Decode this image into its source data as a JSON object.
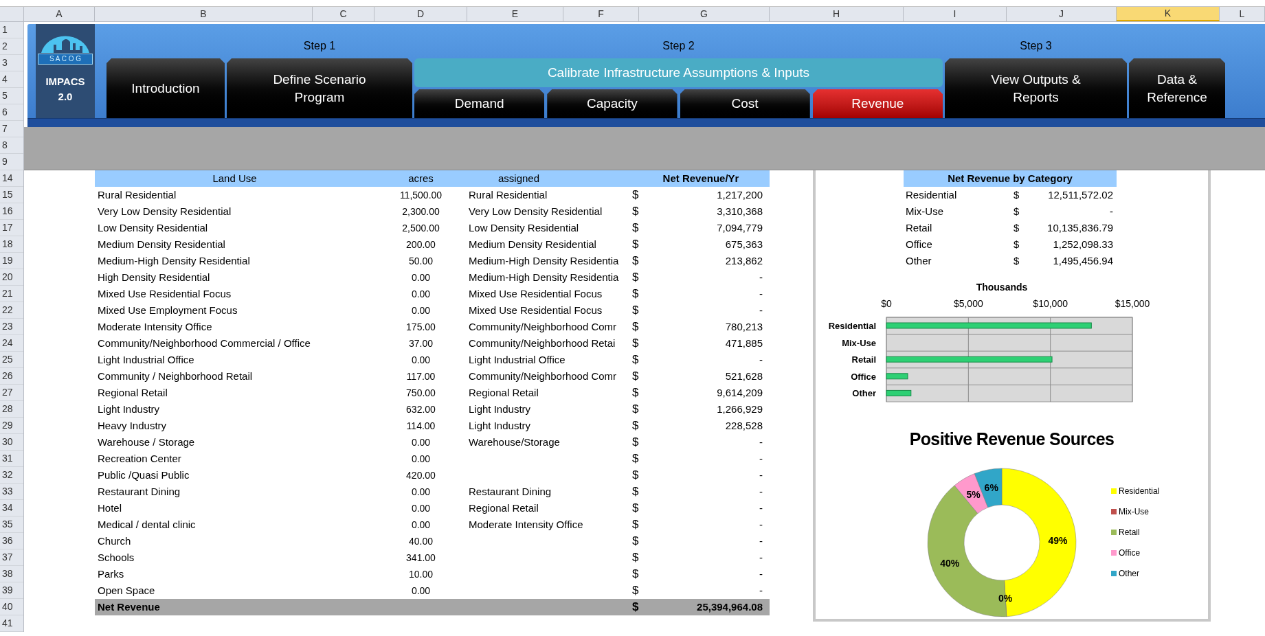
{
  "columns": [
    {
      "letter": "A",
      "selected": false
    },
    {
      "letter": "B",
      "selected": false
    },
    {
      "letter": "C",
      "selected": false
    },
    {
      "letter": "D",
      "selected": false
    },
    {
      "letter": "E",
      "selected": false
    },
    {
      "letter": "F",
      "selected": false
    },
    {
      "letter": "G",
      "selected": false
    },
    {
      "letter": "H",
      "selected": false
    },
    {
      "letter": "I",
      "selected": false
    },
    {
      "letter": "J",
      "selected": false
    },
    {
      "letter": "K",
      "selected": true
    },
    {
      "letter": "L",
      "selected": false
    }
  ],
  "row_numbers": [
    "1",
    "2",
    "3",
    "4",
    "5",
    "6",
    "7",
    "8",
    "9",
    "14",
    "15",
    "16",
    "17",
    "18",
    "19",
    "20",
    "21",
    "22",
    "23",
    "24",
    "25",
    "26",
    "27",
    "28",
    "29",
    "30",
    "31",
    "32",
    "33",
    "34",
    "35",
    "36",
    "37",
    "38",
    "39",
    "40",
    "41"
  ],
  "banner": {
    "logo_text": "S A C O G",
    "app_name": "IMPACS 2.0",
    "nav": [
      {
        "tabs": [
          {
            "label": "Introduction",
            "selected": false
          }
        ]
      },
      {
        "step": "Step 1",
        "tabs": [
          {
            "label": "Define Scenario Program",
            "selected": false
          }
        ]
      },
      {
        "step": "Step 2",
        "heading": "Calibrate Infrastructure Assumptions & Inputs",
        "tabs": [
          {
            "label": "Demand",
            "selected": false
          },
          {
            "label": "Capacity",
            "selected": false
          },
          {
            "label": "Cost",
            "selected": false
          },
          {
            "label": "Revenue",
            "selected": true
          }
        ]
      },
      {
        "step": "Step 3",
        "tabs": [
          {
            "label": "View Outputs & Reports",
            "selected": false
          }
        ]
      },
      {
        "tabs": [
          {
            "label": "Data & Reference",
            "selected": false
          }
        ]
      }
    ]
  },
  "land_use_table": {
    "columns": [
      "Land Use",
      "acres",
      "assigned",
      "Net Revenue/Yr"
    ],
    "rows": [
      {
        "land_use": "Rural Residential",
        "acres": "11,500.00",
        "assigned": "Rural Residential",
        "currency": "$",
        "net_revenue": "1,217,200"
      },
      {
        "land_use": "Very Low Density Residential",
        "acres": "2,300.00",
        "assigned": "Very Low Density Residential",
        "currency": "$",
        "net_revenue": "3,310,368"
      },
      {
        "land_use": "Low Density Residential",
        "acres": "2,500.00",
        "assigned": "Low Density Residential",
        "currency": "$",
        "net_revenue": "7,094,779"
      },
      {
        "land_use": "Medium Density Residential",
        "acres": "200.00",
        "assigned": "Medium Density Residential",
        "currency": "$",
        "net_revenue": "675,363"
      },
      {
        "land_use": "Medium-High Density Residential",
        "acres": "50.00",
        "assigned": "Medium-High Density Residentia",
        "currency": "$",
        "net_revenue": "213,862"
      },
      {
        "land_use": "High Density Residential",
        "acres": "0.00",
        "assigned": "Medium-High Density Residentia",
        "currency": "$",
        "net_revenue": "-"
      },
      {
        "land_use": "Mixed Use Residential Focus",
        "acres": "0.00",
        "assigned": "Mixed Use Residential Focus",
        "currency": "$",
        "net_revenue": "-"
      },
      {
        "land_use": "Mixed Use Employment Focus",
        "acres": "0.00",
        "assigned": "Mixed Use Residential Focus",
        "currency": "$",
        "net_revenue": "-"
      },
      {
        "land_use": "Moderate Intensity Office",
        "acres": "175.00",
        "assigned": "Community/Neighborhood Comr",
        "currency": "$",
        "net_revenue": "780,213"
      },
      {
        "land_use": "Community/Neighborhood Commercial / Office",
        "acres": "37.00",
        "assigned": "Community/Neighborhood Retai",
        "currency": "$",
        "net_revenue": "471,885"
      },
      {
        "land_use": "Light Industrial Office",
        "acres": "0.00",
        "assigned": "Light Industrial Office",
        "currency": "$",
        "net_revenue": "-"
      },
      {
        "land_use": "Community / Neighborhood Retail",
        "acres": "117.00",
        "assigned": "Community/Neighborhood Comr",
        "currency": "$",
        "net_revenue": "521,628"
      },
      {
        "land_use": "Regional Retail",
        "acres": "750.00",
        "assigned": "Regional Retail",
        "currency": "$",
        "net_revenue": "9,614,209"
      },
      {
        "land_use": "Light Industry",
        "acres": "632.00",
        "assigned": "Light Industry",
        "currency": "$",
        "net_revenue": "1,266,929"
      },
      {
        "land_use": "Heavy Industry",
        "acres": "114.00",
        "assigned": "Light Industry",
        "currency": "$",
        "net_revenue": "228,528"
      },
      {
        "land_use": "Warehouse / Storage",
        "acres": "0.00",
        "assigned": "Warehouse/Storage",
        "currency": "$",
        "net_revenue": "-"
      },
      {
        "land_use": "Recreation Center",
        "acres": "0.00",
        "currency": "$",
        "net_revenue": "-"
      },
      {
        "land_use": "Public /Quasi Public",
        "acres": "420.00",
        "currency": "$",
        "net_revenue": "-"
      },
      {
        "land_use": "Restaurant Dining",
        "acres": "0.00",
        "assigned": "Restaurant Dining",
        "currency": "$",
        "net_revenue": "-"
      },
      {
        "land_use": "Hotel",
        "acres": "0.00",
        "assigned": "Regional Retail",
        "currency": "$",
        "net_revenue": "-"
      },
      {
        "land_use": "Medical / dental clinic",
        "acres": "0.00",
        "assigned": "Moderate Intensity Office",
        "currency": "$",
        "net_revenue": "-"
      },
      {
        "land_use": "Church",
        "acres": "40.00",
        "currency": "$",
        "net_revenue": "-"
      },
      {
        "land_use": "Schools",
        "acres": "341.00",
        "currency": "$",
        "net_revenue": "-"
      },
      {
        "land_use": "Parks",
        "acres": "10.00",
        "currency": "$",
        "net_revenue": "-"
      },
      {
        "land_use": "Open Space",
        "acres": "0.00",
        "currency": "$",
        "net_revenue": "-"
      }
    ],
    "total": {
      "label": "Net Revenue",
      "currency": "$",
      "value": "25,394,964.08"
    }
  },
  "category_table": {
    "title": "Net Revenue by Category",
    "rows": [
      {
        "category": "Residential",
        "currency": "$",
        "value": "12,511,572.02"
      },
      {
        "category": "Mix-Use",
        "currency": "$",
        "value": "-"
      },
      {
        "category": "Retail",
        "currency": "$",
        "value": "10,135,836.79"
      },
      {
        "category": "Office",
        "currency": "$",
        "value": "1,252,098.33"
      },
      {
        "category": "Other",
        "currency": "$",
        "value": "1,495,456.94"
      }
    ]
  },
  "bar_chart": {
    "chart_data": {
      "type": "bar",
      "orientation": "horizontal",
      "xlabel": "Thousands",
      "categories": [
        "Residential",
        "Mix-Use",
        "Retail",
        "Office",
        "Other"
      ],
      "values": [
        12500,
        0,
        10100,
        1300,
        1500
      ],
      "xlim": [
        0,
        15000
      ],
      "xticks": [
        {
          "value": 0,
          "label": "$0"
        },
        {
          "value": 5000,
          "label": "$5,000"
        },
        {
          "value": 10000,
          "label": "$10,000"
        },
        {
          "value": 15000,
          "label": "$15,000"
        }
      ]
    }
  },
  "donut_chart": {
    "chart_data": {
      "type": "donut",
      "title": "Positive Revenue Sources",
      "categories": [
        "Residential",
        "Mix-Use",
        "Retail",
        "Office",
        "Other"
      ],
      "values": [
        49,
        0,
        40,
        5,
        6
      ],
      "value_labels": [
        "49%",
        "0%",
        "40%",
        "5%",
        "6%"
      ],
      "legend": "right"
    }
  }
}
